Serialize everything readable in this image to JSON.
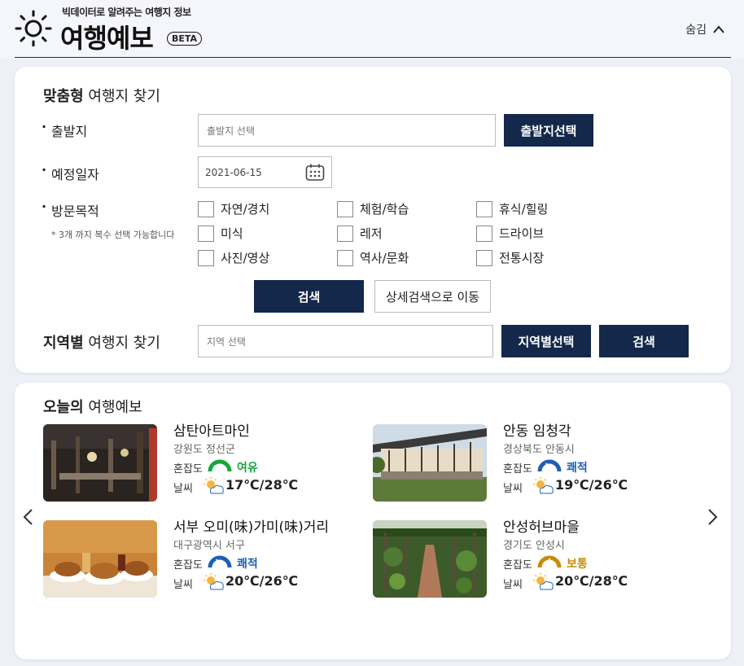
{
  "header": {
    "tagline": "빅데이터로 알려주는 여행지 정보",
    "brand": "여행예보",
    "beta": "BETA",
    "hide_label": "숨김"
  },
  "custom_search": {
    "title_bold": "맞춤형",
    "title_rest": " 여행지 찾기",
    "departure_label": "출발지",
    "departure_placeholder": "출발지 선택",
    "departure_button": "출발지선택",
    "date_label": "예정일자",
    "date_value": "2021-06-15",
    "purpose_label": "방문목적",
    "purpose_hint": "* 3개 까지 복수 선택 가능합니다",
    "purposes": [
      "자연/경치",
      "체험/학습",
      "휴식/힐링",
      "미식",
      "레저",
      "드라이브",
      "사진/영상",
      "역사/문화",
      "전통시장"
    ],
    "search_button": "검색",
    "detail_button": "상세검색으로 이동"
  },
  "region_search": {
    "title_bold": "지역별",
    "title_rest": " 여행지 찾기",
    "placeholder": "지역 선택",
    "select_button": "지역별선택",
    "search_button": "검색"
  },
  "today": {
    "title_bold": "오늘의",
    "title_rest": " 여행예보",
    "crowd_label": "혼잡도",
    "weather_label": "날씨",
    "items": [
      {
        "name": "삼탄아트마인",
        "region": "강원도 정선군",
        "status": "여유",
        "status_color": "#1aa53a",
        "temp": "17℃/28℃"
      },
      {
        "name": "안동 임청각",
        "region": "경상북도 안동시",
        "status": "쾌적",
        "status_color": "#1e5fb8",
        "temp": "19℃/26℃"
      },
      {
        "name": "서부 오미(味)가미(味)거리",
        "region": "대구광역시 서구",
        "status": "쾌적",
        "status_color": "#1e5fb8",
        "temp": "20℃/26℃"
      },
      {
        "name": "안성허브마을",
        "region": "경기도 안성시",
        "status": "보통",
        "status_color": "#c98a0c",
        "temp": "20℃/28℃"
      }
    ]
  }
}
